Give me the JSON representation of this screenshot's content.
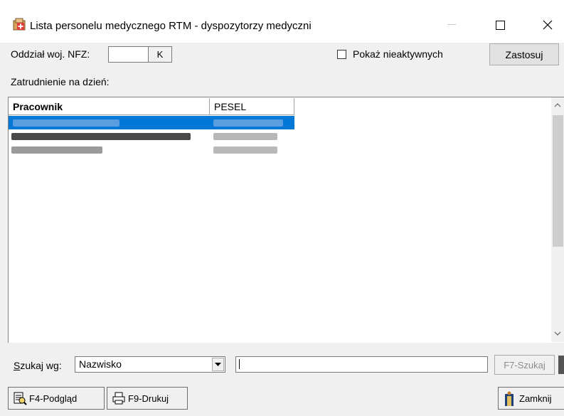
{
  "window": {
    "title": "Lista personelu medycznego RTM - dyspozytorzy medyczni",
    "icon": "medical-list-icon"
  },
  "filters": {
    "nfz_label": "Oddział woj. NFZ:",
    "nfz_value": "",
    "nfz_button": "K",
    "inactive_label": "Pokaż nieaktywnych",
    "inactive_checked": false,
    "apply_label": "Zastosuj",
    "employment_label": "Zatrudnienie na dzień:"
  },
  "table": {
    "columns": [
      "Pracownik",
      "PESEL"
    ],
    "selected_row": 0,
    "rows_note_blurred": true
  },
  "search": {
    "label": "Szukaj wg:",
    "field_value": "Nazwisko",
    "query": "",
    "button_label": "F7-Szukaj"
  },
  "buttons": {
    "preview_label": "F4-Podgląd",
    "print_label": "F9-Drukuj",
    "close_label": "Zamknij"
  },
  "colors": {
    "selection": "#0078d7",
    "window_bg": "#f0f0f0"
  }
}
